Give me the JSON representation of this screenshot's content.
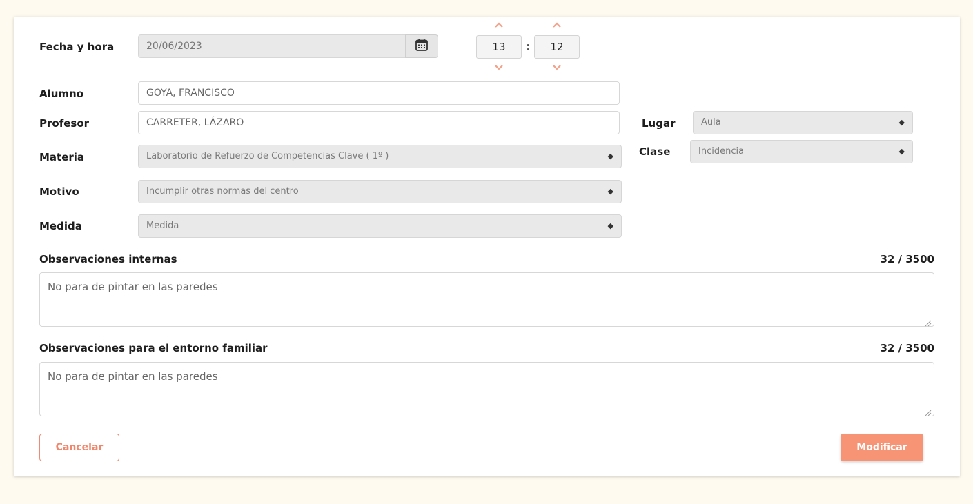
{
  "form": {
    "fecha_label": "Fecha y hora",
    "fecha_value": "20/06/2023",
    "hora": {
      "hour": "13",
      "separator": ":",
      "minute": "12"
    },
    "alumno_label": "Alumno",
    "alumno_value": "GOYA, FRANCISCO",
    "profesor_label": "Profesor",
    "profesor_value": "CARRETER, LÁZARO",
    "lugar_label": "Lugar",
    "lugar_value": "Aula",
    "materia_label": "Materia",
    "materia_value": "Laboratorio de Refuerzo de Competencias Clave ( 1º )",
    "clase_label": "Clase",
    "clase_value": "Incidencia",
    "motivo_label": "Motivo",
    "motivo_value": "Incumplir otras normas del centro",
    "medida_label": "Medida",
    "medida_placeholder": "Medida",
    "obs_internas_label": "Observaciones internas",
    "obs_internas_counter": "32 / 3500",
    "obs_internas_value": "No para de pintar en las paredes",
    "obs_familiar_label": "Observaciones para el entorno familiar",
    "obs_familiar_counter": "32 / 3500",
    "obs_familiar_value": "No para de pintar en las paredes"
  },
  "actions": {
    "cancel_label": "Cancelar",
    "submit_label": "Modificar"
  },
  "icons": {
    "calendar": "calendar-icon",
    "up": "chevron-up-icon",
    "down": "chevron-down-icon",
    "select_caret": "sort-caret-icon",
    "resize": "resize-grip-icon"
  },
  "colors": {
    "accent": "#f69475",
    "arrow": "#f2a18a",
    "page_bg": "#fefaf0"
  }
}
